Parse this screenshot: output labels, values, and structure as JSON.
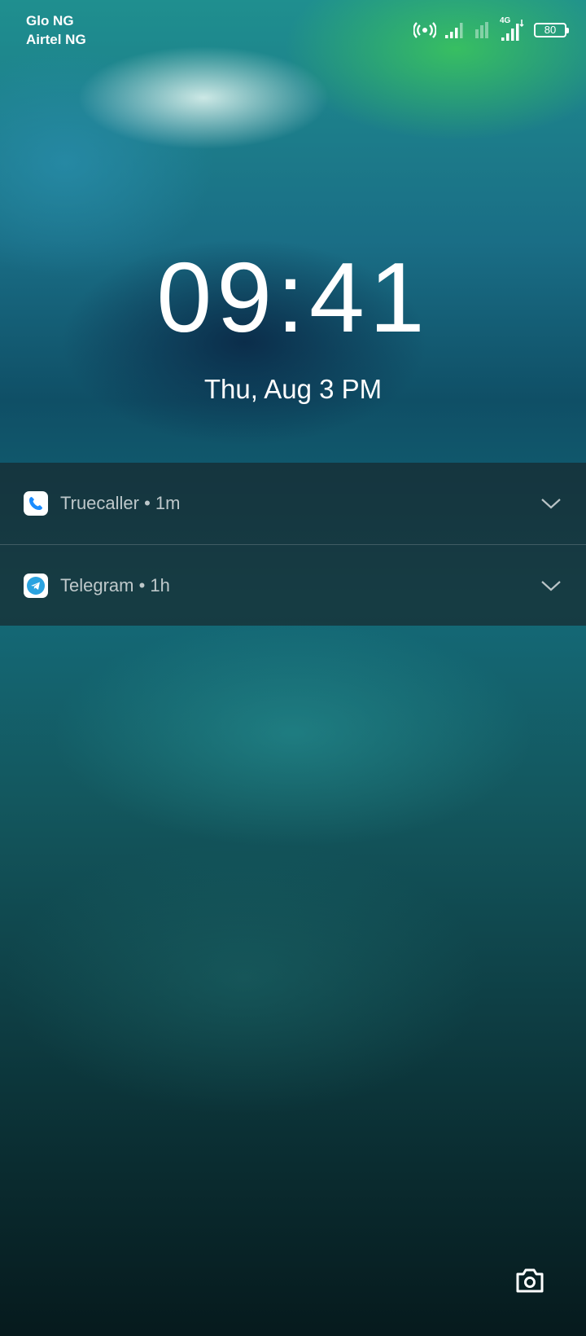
{
  "status_bar": {
    "carrier_1": "Glo NG",
    "carrier_2": "Airtel NG",
    "network_type": "4G",
    "battery_level": "80",
    "icons": [
      "hotspot-icon",
      "signal-icon",
      "signal-icon",
      "signal-icon",
      "battery-icon"
    ]
  },
  "lockscreen": {
    "time": "09:41",
    "date": "Thu, Aug 3  PM"
  },
  "notifications": [
    {
      "app": "Truecaller",
      "time": "1m",
      "label": "Truecaller • 1m",
      "icon": "truecaller-icon"
    },
    {
      "app": "Telegram",
      "time": "1h",
      "label": "Telegram • 1h",
      "icon": "telegram-icon"
    }
  ],
  "shortcuts": {
    "camera_icon": "camera-icon"
  },
  "colors": {
    "truecaller": "#1a8cff",
    "telegram": "#2aa3e0",
    "notification_bg": "#182024"
  }
}
